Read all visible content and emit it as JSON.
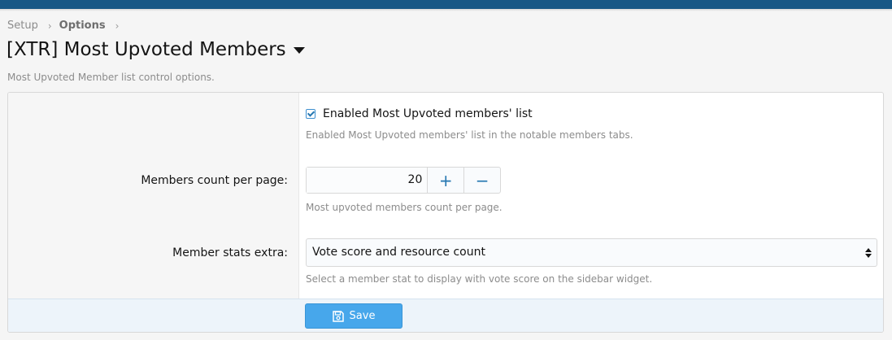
{
  "breadcrumb": {
    "items": [
      "Setup",
      "Options"
    ]
  },
  "page": {
    "title": "[XTR] Most Upvoted Members",
    "description": "Most Upvoted Member list control options."
  },
  "options": {
    "enabled": {
      "label": "Enabled Most Upvoted members' list",
      "checked": true,
      "hint": "Enabled Most Upvoted members' list in the notable members tabs."
    },
    "members_count": {
      "label": "Members count per page:",
      "value": "20",
      "increment_symbol": "+",
      "decrement_symbol": "−",
      "hint": "Most upvoted members count per page."
    },
    "member_stats": {
      "label": "Member stats extra:",
      "selected": "Vote score and resource count",
      "hint": "Select a member stat to display with vote score on the sidebar widget."
    }
  },
  "footer": {
    "save_label": "Save"
  },
  "colors": {
    "accent": "#47a7eb",
    "topbar": "#185886",
    "link_blue": "#2577b1"
  },
  "icons": {
    "save": "floppy-disk-icon",
    "title_menu": "caret-down-icon",
    "breadcrumb_sep": "chevron-right-icon"
  }
}
